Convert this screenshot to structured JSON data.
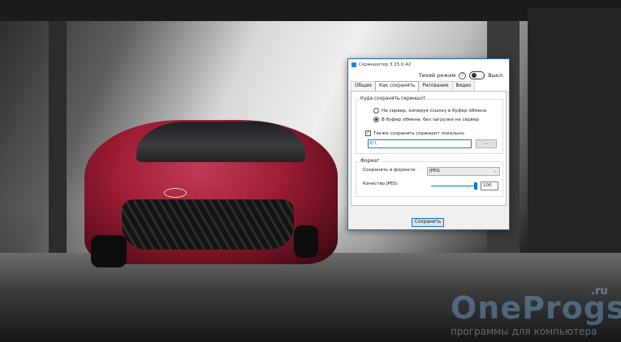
{
  "window": {
    "title": "Скриншотер 3.15.0.42",
    "mode_label": "Тихий режим",
    "help": "?",
    "toggle_state": "Выкл."
  },
  "tabs": [
    {
      "label": "Общие"
    },
    {
      "label": "Как сохранять"
    },
    {
      "label": "Рисование"
    },
    {
      "label": "Видео"
    }
  ],
  "save_location": {
    "group_title": "Куда сохранять скриншот",
    "option_server": "На сервер, копируя ссылку в буфер обмена",
    "option_clipboard": "В буфер обмена, без загрузки на сервер",
    "local_save_label": "Также сохранять скриншот локально:",
    "path_value": "C:\\",
    "browse_label": "...",
    "selected_option": "clipboard",
    "local_save_checked": true
  },
  "format": {
    "group_title": "Формат",
    "format_label": "Сохранять в формате:",
    "format_value": "JPEG",
    "quality_label": "Качество JPEG:",
    "quality_value": "100",
    "quality_fraction": 1.0
  },
  "footer": {
    "save_label": "Сохранить"
  },
  "watermark": {
    "brand": "OneProgs",
    "tld": ".ru",
    "tagline": "программы для компьютера"
  },
  "colors": {
    "accent": "#0078d7",
    "window_border": "#1f6fb5"
  }
}
